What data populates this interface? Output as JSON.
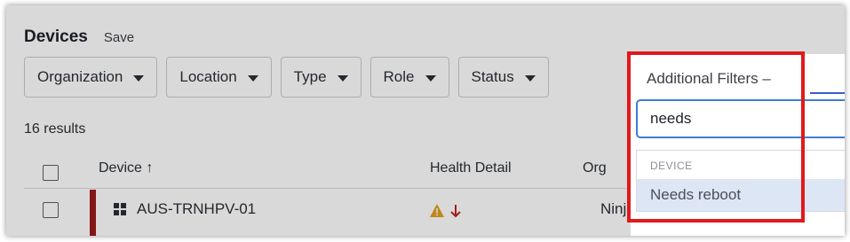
{
  "header": {
    "title": "Devices",
    "save_label": "Save"
  },
  "filters": [
    {
      "label": "Organization"
    },
    {
      "label": "Location"
    },
    {
      "label": "Type"
    },
    {
      "label": "Role"
    },
    {
      "label": "Status"
    }
  ],
  "results_text": "16 results",
  "table": {
    "columns": [
      "Device",
      "Health Detail",
      "Org"
    ],
    "sort_indicator": "↑",
    "rows": [
      {
        "device": "AUS-TRNHPV-01",
        "org": "Ninj"
      }
    ]
  },
  "additional_filters": {
    "label": "Additional Filters –",
    "search_value": "needs",
    "group_header": "DEVICE",
    "option": "Needs reboot"
  },
  "colors": {
    "highlight_border": "#e0191b",
    "accent_blue": "#3d7dd8",
    "row_status_bar": "#9c1b1b",
    "warning": "#e0a020",
    "down_arrow": "#c42020"
  }
}
